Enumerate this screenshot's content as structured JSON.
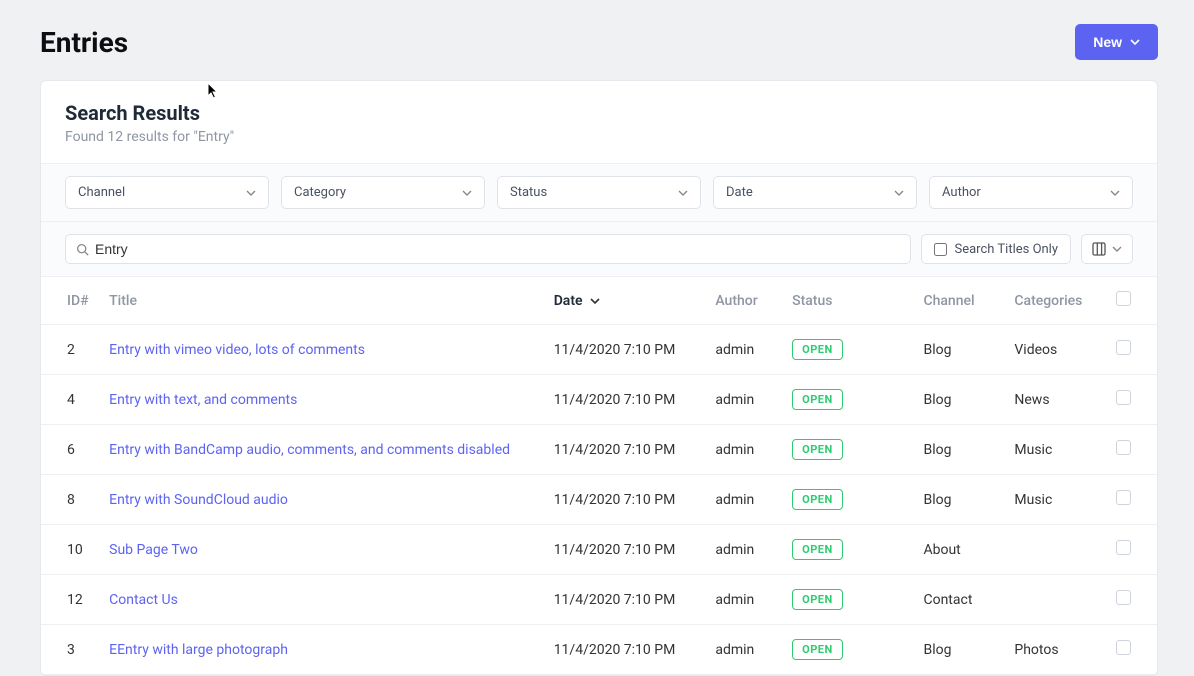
{
  "pageTitle": "Entries",
  "newButton": "New",
  "searchResults": {
    "title": "Search Results",
    "subtitle": "Found 12 results for \"Entry\""
  },
  "filters": {
    "channel": "Channel",
    "category": "Category",
    "status": "Status",
    "date": "Date",
    "author": "Author"
  },
  "search": {
    "value": "Entry",
    "titlesOnly": "Search Titles Only"
  },
  "columns": {
    "id": "ID#",
    "title": "Title",
    "date": "Date",
    "author": "Author",
    "status": "Status",
    "channel": "Channel",
    "categories": "Categories"
  },
  "statusLabel": "OPEN",
  "rows": [
    {
      "id": "2",
      "title": "Entry with vimeo video, lots of comments",
      "date": "11/4/2020 7:10 PM",
      "author": "admin",
      "status": "OPEN",
      "channel": "Blog",
      "categories": "Videos"
    },
    {
      "id": "4",
      "title": "Entry with text, and comments",
      "date": "11/4/2020 7:10 PM",
      "author": "admin",
      "status": "OPEN",
      "channel": "Blog",
      "categories": "News"
    },
    {
      "id": "6",
      "title": "Entry with BandCamp audio, comments, and comments disabled",
      "date": "11/4/2020 7:10 PM",
      "author": "admin",
      "status": "OPEN",
      "channel": "Blog",
      "categories": "Music"
    },
    {
      "id": "8",
      "title": "Entry with SoundCloud audio",
      "date": "11/4/2020 7:10 PM",
      "author": "admin",
      "status": "OPEN",
      "channel": "Blog",
      "categories": "Music"
    },
    {
      "id": "10",
      "title": "Sub Page Two",
      "date": "11/4/2020 7:10 PM",
      "author": "admin",
      "status": "OPEN",
      "channel": "About",
      "categories": ""
    },
    {
      "id": "12",
      "title": "Contact Us",
      "date": "11/4/2020 7:10 PM",
      "author": "admin",
      "status": "OPEN",
      "channel": "Contact",
      "categories": ""
    },
    {
      "id": "3",
      "title": "EEntry with large photograph",
      "date": "11/4/2020 7:10 PM",
      "author": "admin",
      "status": "OPEN",
      "channel": "Blog",
      "categories": "Photos"
    }
  ]
}
